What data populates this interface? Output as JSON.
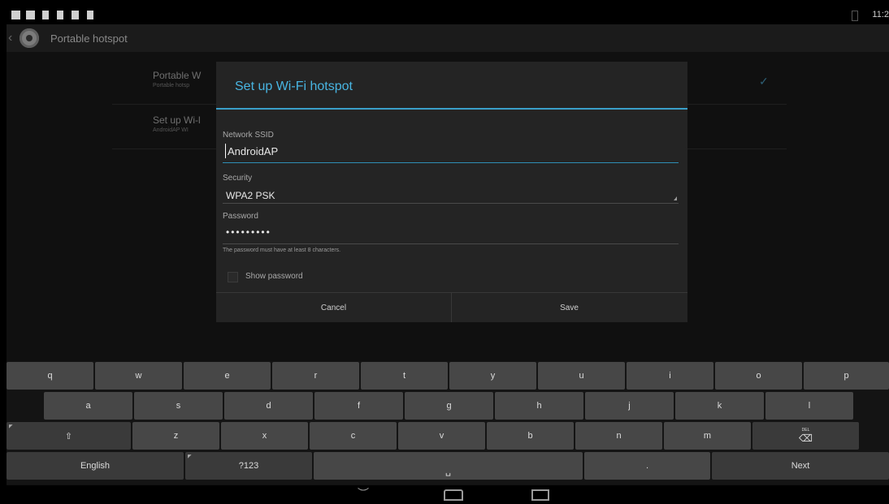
{
  "statusbar": {
    "time": "11:2"
  },
  "actionbar": {
    "title": "Portable hotspot"
  },
  "background_list": {
    "items": [
      {
        "title": "Portable W",
        "subtitle": "Portable hotsp"
      },
      {
        "title": "Set up Wi-l",
        "subtitle": "AndroidAP WI"
      }
    ],
    "checkmark": "✓"
  },
  "dialog": {
    "title": "Set up Wi-Fi hotspot",
    "ssid": {
      "label": "Network SSID",
      "value": "AndroidAP"
    },
    "security": {
      "label": "Security",
      "value": "WPA2 PSK"
    },
    "password": {
      "label": "Password",
      "value": "•••••••••",
      "hint": "The password must have at least 8 characters."
    },
    "show_password": {
      "label": "Show password",
      "checked": false
    },
    "buttons": {
      "cancel": "Cancel",
      "save": "Save"
    }
  },
  "keyboard": {
    "row1": [
      "q",
      "w",
      "e",
      "r",
      "t",
      "y",
      "u",
      "i",
      "o",
      "p"
    ],
    "row2": [
      "a",
      "s",
      "d",
      "f",
      "g",
      "h",
      "j",
      "k",
      "l"
    ],
    "row3": {
      "shift": "⇧",
      "keys": [
        "z",
        "x",
        "c",
        "v",
        "b",
        "n",
        "m"
      ],
      "delete": "⌫",
      "delete_small": "DEL"
    },
    "row4": {
      "language": "English",
      "symbols": "?123",
      "space": "␣",
      "period": ".",
      "next": "Next"
    }
  },
  "navbar": {
    "back": "︶"
  }
}
